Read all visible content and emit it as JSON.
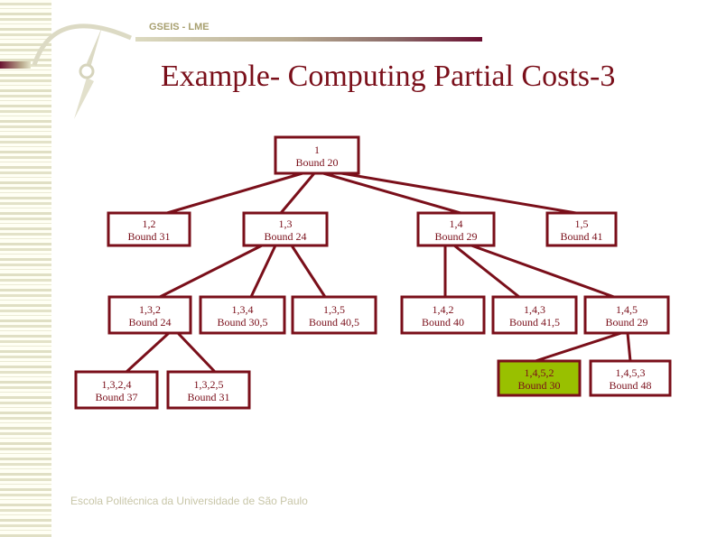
{
  "header": {
    "label": "GSEIS - LME"
  },
  "slide": {
    "title": "Example- Computing Partial Costs-3",
    "footer": "Escola Politécnica da Universidade de São Paulo"
  },
  "colors": {
    "node_border": "#7a0f1a",
    "node_text": "#7a0f1a",
    "highlight_fill": "#99c000",
    "default_fill": "#ffffff"
  },
  "tree": {
    "nodes": [
      {
        "id": "n1",
        "path": "1",
        "bound": "Bound 20",
        "parent": null,
        "highlight": false
      },
      {
        "id": "n12",
        "path": "1,2",
        "bound": "Bound 31",
        "parent": "n1",
        "highlight": false
      },
      {
        "id": "n13",
        "path": "1,3",
        "bound": "Bound 24",
        "parent": "n1",
        "highlight": false
      },
      {
        "id": "n14",
        "path": "1,4",
        "bound": "Bound 29",
        "parent": "n1",
        "highlight": false
      },
      {
        "id": "n15",
        "path": "1,5",
        "bound": "Bound 41",
        "parent": "n1",
        "highlight": false
      },
      {
        "id": "n132",
        "path": "1,3,2",
        "bound": "Bound 24",
        "parent": "n13",
        "highlight": false
      },
      {
        "id": "n134",
        "path": "1,3,4",
        "bound": "Bound 30,5",
        "parent": "n13",
        "highlight": false
      },
      {
        "id": "n135",
        "path": "1,3,5",
        "bound": "Bound 40,5",
        "parent": "n13",
        "highlight": false
      },
      {
        "id": "n142",
        "path": "1,4,2",
        "bound": "Bound 40",
        "parent": "n14",
        "highlight": false
      },
      {
        "id": "n143",
        "path": "1,4,3",
        "bound": "Bound 41,5",
        "parent": "n14",
        "highlight": false
      },
      {
        "id": "n145",
        "path": "1,4,5",
        "bound": "Bound 29",
        "parent": "n14",
        "highlight": false
      },
      {
        "id": "n1324",
        "path": "1,3,2,4",
        "bound": "Bound 37",
        "parent": "n132",
        "highlight": false
      },
      {
        "id": "n1325",
        "path": "1,3,2,5",
        "bound": "Bound 31",
        "parent": "n132",
        "highlight": false
      },
      {
        "id": "n1452",
        "path": "1,4,5,2",
        "bound": "Bound 30",
        "parent": "n145",
        "highlight": true
      },
      {
        "id": "n1453",
        "path": "1,4,5,3",
        "bound": "Bound 48",
        "parent": "n145",
        "highlight": false
      }
    ]
  }
}
